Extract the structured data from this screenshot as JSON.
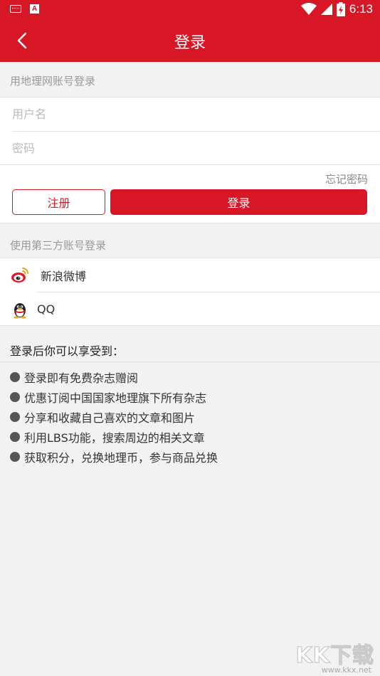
{
  "status_bar": {
    "time": "6:13",
    "left_icons": [
      "keyboard-icon",
      "a-notification-icon"
    ],
    "right_icons": [
      "wifi-icon",
      "signal-icon",
      "battery-charging-icon"
    ]
  },
  "header": {
    "title": "登录",
    "back_icon": "chevron-left-icon"
  },
  "account_login": {
    "section_label": "用地理网账号登录",
    "username": {
      "value": "",
      "placeholder": "用户名"
    },
    "password": {
      "value": "",
      "placeholder": "密码"
    },
    "forgot_password": "忘记密码",
    "register_label": "注册",
    "login_label": "登录"
  },
  "third_party": {
    "section_label": "使用第三方账号登录",
    "items": [
      {
        "label": "新浪微博",
        "icon": "weibo-icon"
      },
      {
        "label": "QQ",
        "icon": "qq-penguin-icon"
      }
    ]
  },
  "benefits": {
    "title": "登录后你可以享受到：",
    "items": [
      "登录即有免费杂志赠阅",
      "优惠订阅中国国家地理旗下所有杂志",
      "分享和收藏自己喜欢的文章和图片",
      "利用LBS功能，搜索周边的相关文章",
      "获取积分，兑换地理币，参与商品兑换"
    ]
  },
  "watermark": {
    "text": "KK下载",
    "url": "www.kkx.net"
  },
  "colors": {
    "brand_red": "#d81726",
    "background": "#f2f2f2",
    "muted_text": "#999999"
  }
}
